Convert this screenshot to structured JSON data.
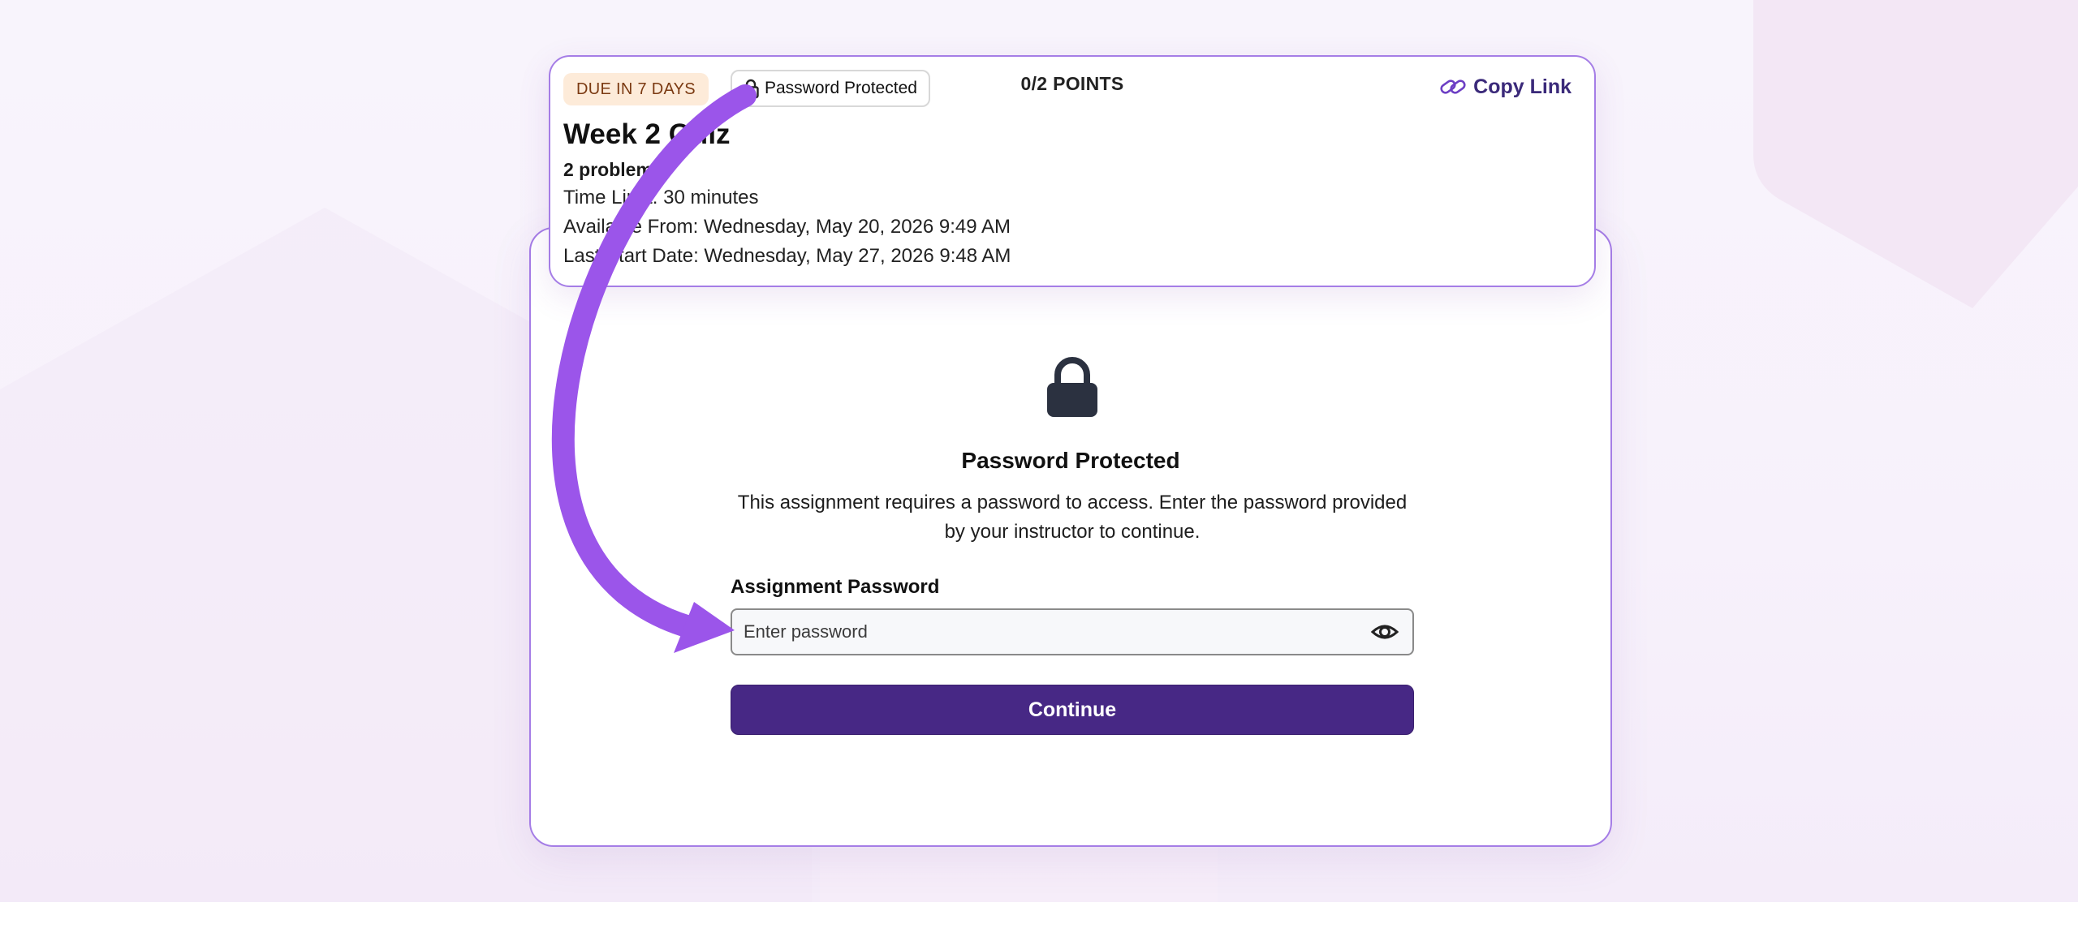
{
  "assignment": {
    "due_badge": "DUE IN 7 DAYS",
    "protection_badge": "Password Protected",
    "points": "0/2 POINTS",
    "copy_link": "Copy Link",
    "title": "Week 2 Quiz",
    "problems": "2 problems",
    "time_limit": "Time Limit: 30 minutes",
    "available_from": "Available From: Wednesday, May 20, 2026 9:49 AM",
    "last_start_date": "Last Start Date: Wednesday, May 27, 2026 9:48 AM"
  },
  "gate": {
    "title": "Password Protected",
    "description": "This assignment requires a password to access. Enter the password provided by your instructor to continue.",
    "field_label": "Assignment Password",
    "field_placeholder": "Enter password",
    "field_value": "",
    "submit_label": "Continue"
  },
  "icons": {
    "badge": "lock-icon",
    "copy": "link-icon",
    "gate": "lock-icon",
    "visibility": "eye-icon",
    "annotation": "curved-arrow"
  },
  "colors": {
    "accent": "#472885",
    "card_border": "#a57de6",
    "annotation_arrow": "#9b55ea",
    "due_badge_bg": "#fdebd9",
    "due_badge_text": "#7b3a12"
  }
}
